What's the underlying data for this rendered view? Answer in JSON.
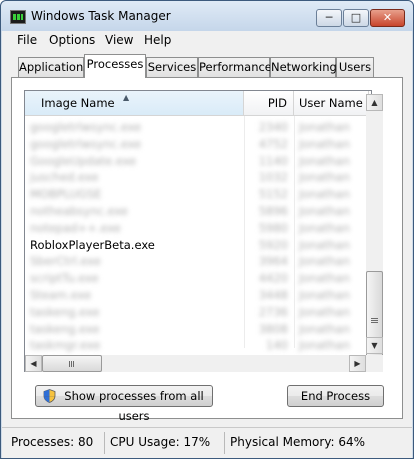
{
  "window": {
    "title": "Windows Task Manager",
    "controls": {
      "minimize": "─",
      "maximize": "□",
      "close": "✕"
    }
  },
  "menu": [
    "File",
    "Options",
    "View",
    "Help"
  ],
  "tabs": [
    {
      "label": "Applications",
      "active": false
    },
    {
      "label": "Processes",
      "active": true
    },
    {
      "label": "Services",
      "active": false
    },
    {
      "label": "Performance",
      "active": false
    },
    {
      "label": "Networking",
      "active": false
    },
    {
      "label": "Users",
      "active": false
    }
  ],
  "processes": {
    "columns": {
      "image_name": "Image Name",
      "pid": "PID",
      "user_name": "User Name"
    },
    "sort_indicator": "▲",
    "rows": [
      {
        "name": "googletrlwsync.exe",
        "pid": "2340",
        "user": "Jonathan",
        "blurred": true
      },
      {
        "name": "googletrlwsync.exe",
        "pid": "4752",
        "user": "Jonathan",
        "blurred": true
      },
      {
        "name": "GoogleUpdate.exe",
        "pid": "1140",
        "user": "Jonathan",
        "blurred": true
      },
      {
        "name": "jusched.exe",
        "pid": "1032",
        "user": "Jonathan",
        "blurred": true
      },
      {
        "name": "MOBPLUGSE",
        "pid": "5152",
        "user": "Jonathan",
        "blurred": true
      },
      {
        "name": "notheabsync.exe",
        "pid": "5896",
        "user": "Jonathan",
        "blurred": true
      },
      {
        "name": "notepad++.exe",
        "pid": "5980",
        "user": "Jonathan",
        "blurred": true
      },
      {
        "name": "RobloxPlayerBeta.exe",
        "pid": "5920",
        "user": "Jonathan",
        "blurred": false,
        "pid_blurred": true,
        "user_blurred": true
      },
      {
        "name": "SberCtrl.exe",
        "pid": "3964",
        "user": "Jonathan",
        "blurred": true
      },
      {
        "name": "scriptTu.exe",
        "pid": "4420",
        "user": "Jonathan",
        "blurred": true
      },
      {
        "name": "Steam.exe",
        "pid": "3448",
        "user": "Jonathan",
        "blurred": true
      },
      {
        "name": "taskeng.exe",
        "pid": "2736",
        "user": "Jonathan",
        "blurred": true
      },
      {
        "name": "taskeng.exe",
        "pid": "3808",
        "user": "Jonathan",
        "blurred": true
      },
      {
        "name": "taskmgr.exe",
        "pid": "140",
        "user": "Jonathan",
        "blurred": true
      }
    ]
  },
  "buttons": {
    "show_all": "Show processes from all users",
    "end_process": "End Process"
  },
  "status": {
    "processes": "Processes: 80",
    "cpu": "CPU Usage: 17%",
    "memory": "Physical Memory: 64%"
  },
  "colors": {
    "accent_select": "#d9ebf8",
    "window_frame": "#cfdbe8",
    "close_button": "#c8452c"
  }
}
